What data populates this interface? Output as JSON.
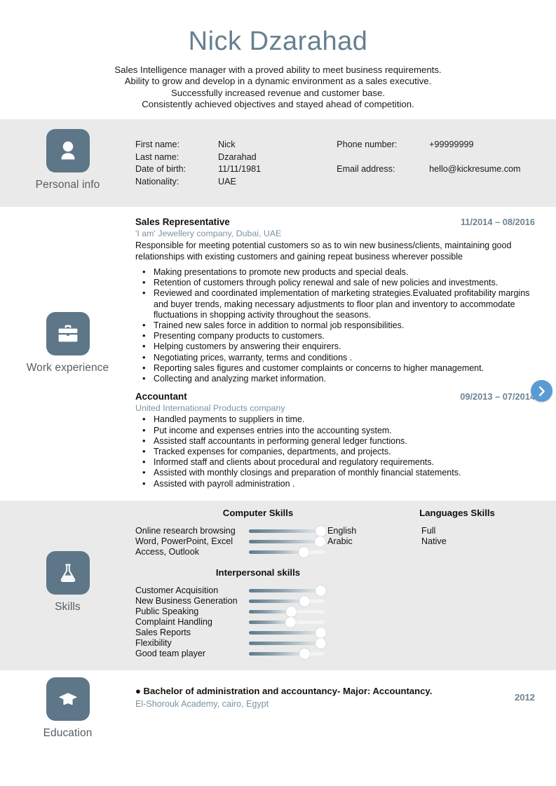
{
  "colors": {
    "accent": "#66808f",
    "icon_bg": "#5d7788",
    "muted_blue": "#7b93a2",
    "date_blue": "#6d8494",
    "section_gray": "#eaeaea",
    "next_button_blue": "#5b9bd5"
  },
  "header": {
    "name": "Nick Dzarahad",
    "summary": [
      "Sales Intelligence manager with a proved ability to meet business requirements.",
      "Ability to grow and develop in a dynamic environment as a sales executive.",
      "Successfully increased revenue and customer base.",
      "Consistently achieved objectives and stayed ahead of competition."
    ]
  },
  "personal_info": {
    "section_label": "Personal info",
    "icon": "person-icon",
    "left_fields": [
      {
        "key": "First name:",
        "value": "Nick"
      },
      {
        "key": "Last name:",
        "value": "Dzarahad"
      },
      {
        "key": "Date of birth:",
        "value": "11/11/1981"
      },
      {
        "key": "Nationality:",
        "value": "UAE"
      }
    ],
    "right_fields": [
      {
        "key": "Phone number:",
        "value": "+99999999"
      },
      {
        "key": "Email address:",
        "value": "hello@kickresume.com"
      }
    ]
  },
  "work_experience": {
    "section_label": "Work experience",
    "icon": "briefcase-icon",
    "jobs": [
      {
        "title": "Sales Representative",
        "date": "11/2014 – 08/2016",
        "company": "'I am' Jewellery company, Dubai, UAE",
        "description": "Responsible for meeting potential customers so as to win new business/clients, maintaining good relationships with existing customers and gaining repeat business wherever possible",
        "bullets": [
          "Making presentations to promote new products and special deals.",
          "Retention of customers through policy renewal and sale of new policies and investments.",
          "Reviewed and coordinated implementation of marketing strategies.Evaluated profitability margins and buyer trends, making necessary adjustments to floor plan and inventory to accommodate fluctuations in shopping activity throughout the seasons.",
          "Trained new sales force in addition to normal job responsibilities.",
          "Presenting company products to customers.",
          "Helping customers by answering their enquirers.",
          "Negotiating prices, warranty, terms and conditions .",
          "Reporting sales figures and customer complaints or concerns to higher management.",
          "Collecting and analyzing market information."
        ]
      },
      {
        "title": "Accountant",
        "date": "09/2013 – 07/2014",
        "company": "United International Products company",
        "description": "",
        "bullets": [
          "Handled payments to suppliers in time.",
          "Put income and expenses entries into the accounting system.",
          "Assisted staff accountants in performing general ledger functions.",
          "Tracked expenses for companies, departments, and projects.",
          "Informed staff and clients about procedural and regulatory requirements.",
          "Assisted with monthly closings and preparation of monthly financial statements.",
          "Assisted with payroll administration ."
        ]
      }
    ]
  },
  "skills": {
    "section_label": "Skills",
    "icon": "flask-icon",
    "computer_skills": {
      "heading": "Computer Skills",
      "items": [
        {
          "name": "Online research browsing",
          "level": 95
        },
        {
          "name": "Word, PowerPoint, Excel",
          "level": 94
        },
        {
          "name": "Access, Outlook",
          "level": 73
        }
      ]
    },
    "language_skills": {
      "heading": "Languages Skills",
      "items": [
        {
          "name": "English",
          "level": "Full"
        },
        {
          "name": "Arabic",
          "level": "Native"
        }
      ]
    },
    "interpersonal_skills": {
      "heading": "Interpersonal skills",
      "items": [
        {
          "name": "Customer Acquisition",
          "level": 95
        },
        {
          "name": "New Business Generation",
          "level": 74
        },
        {
          "name": "Public Speaking",
          "level": 56
        },
        {
          "name": "Complaint Handling",
          "level": 55
        },
        {
          "name": "Sales Reports",
          "level": 95
        },
        {
          "name": "Flexibility",
          "level": 95
        },
        {
          "name": "Good team player",
          "level": 74
        }
      ]
    }
  },
  "education": {
    "section_label": "Education",
    "icon": "graduation-cap-icon",
    "entries": [
      {
        "degree": "● Bachelor of administration and accountancy- Major: Accountancy.",
        "school": "El-Shorouk Academy, cairo, Egypt",
        "year": "2012"
      }
    ]
  },
  "controls": {
    "next_button": "next-page-arrow"
  }
}
